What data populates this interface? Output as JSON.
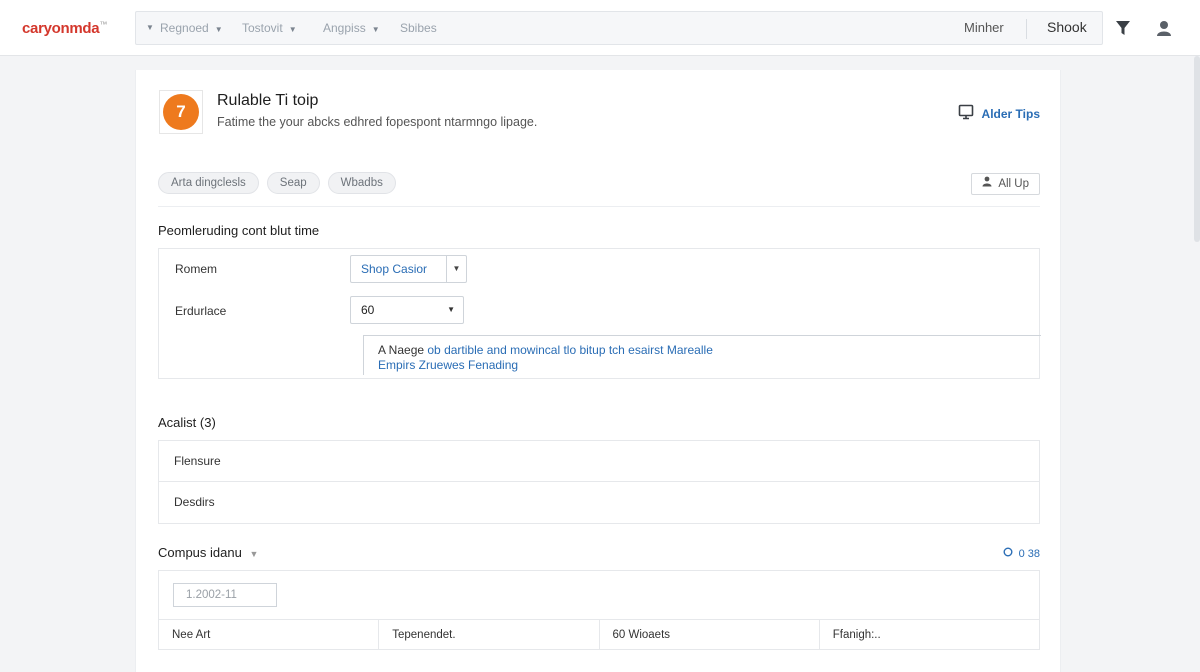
{
  "app": {
    "brand": "caryonmda",
    "brand_mark": "™"
  },
  "topnav": {
    "items": [
      {
        "label": "Regnoed"
      },
      {
        "label": "Tostovit"
      },
      {
        "label": "Angpiss"
      },
      {
        "label": "Sbibes"
      }
    ],
    "right_link": "Minher",
    "right_title": "Shook",
    "icons": [
      "filter-icon",
      "user-icon"
    ]
  },
  "header": {
    "logo_glyph": "7",
    "title": "Rulable Ti toip",
    "subtitle": "Fatime the your abcks edhred fopespont ntarmngo lipage.",
    "tips_label": "Alder Tips",
    "tips_icon": "monitor-icon"
  },
  "chips": [
    "Arta dingclesls",
    "Seap",
    "Wbadbs"
  ],
  "allup": {
    "label": "All Up",
    "icon": "user-icon"
  },
  "section1": {
    "title": "Peomleruding cont blut time",
    "row1_label": "Romem",
    "row1_value": "Shop  Casior",
    "row2_label": "Erdurlace",
    "row2_value": "60",
    "hint_lead": "A Naege",
    "hint_line1": " ob dartible and mowincal tlo bitup tch esairst Marealle",
    "hint_line2": "Empirs Zruewes Fenading"
  },
  "section2": {
    "title": "Acalist (3)",
    "rows": [
      "Flensure",
      "Desdirs"
    ]
  },
  "section3": {
    "title": "Compus idanu",
    "meta": "0 38",
    "date_value": "1.2002-11",
    "columns": [
      "Nee Art",
      "Tepenendet.",
      "60 Wioaets",
      "Ffanigh:.."
    ]
  },
  "colors": {
    "brand": "#d4372c",
    "accent": "#ee7a1e",
    "link": "#2a6db5"
  }
}
